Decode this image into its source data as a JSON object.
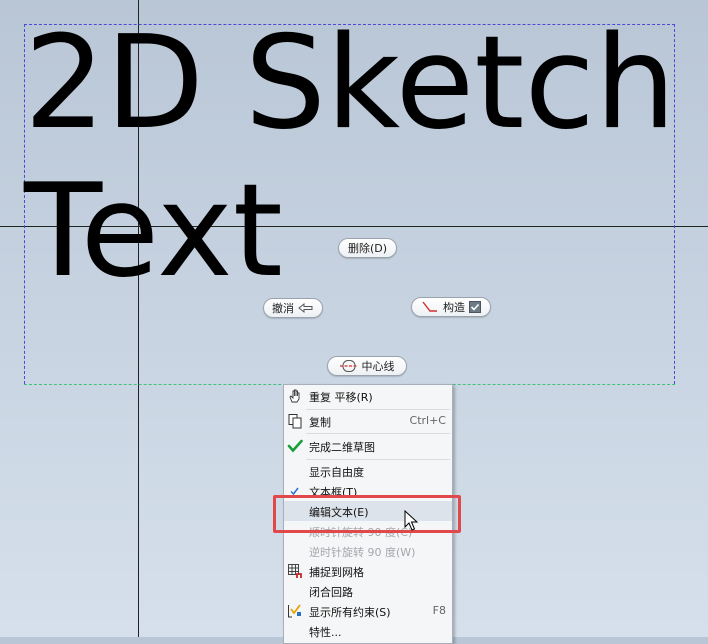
{
  "canvas": {
    "text_line1": "2D Sketch",
    "text_line2": "Text"
  },
  "mini_toolbar": {
    "delete_label": "删除(D)",
    "undo_label": "撤消",
    "construction_label": "构造",
    "centerline_label": "中心线"
  },
  "context_menu": {
    "items": [
      {
        "label": "重复 平移(R)",
        "shortcut": "",
        "icon": "hand-icon",
        "enabled": true
      },
      {
        "label": "复制",
        "shortcut": "Ctrl+C",
        "icon": "copy-icon",
        "enabled": true
      },
      {
        "label": "完成二维草图",
        "shortcut": "",
        "icon": "checkmark-icon",
        "enabled": true
      },
      {
        "label": "显示自由度",
        "shortcut": "",
        "icon": "",
        "enabled": true
      },
      {
        "label": "文本框(T)",
        "shortcut": "",
        "icon": "checkmark-small-icon",
        "enabled": true
      },
      {
        "label": "编辑文本(E)",
        "shortcut": "",
        "icon": "",
        "enabled": true
      },
      {
        "label": "顺时针旋转 90 度(C)",
        "shortcut": "",
        "icon": "",
        "enabled": false
      },
      {
        "label": "逆时针旋转 90 度(W)",
        "shortcut": "",
        "icon": "",
        "enabled": false
      },
      {
        "label": "捕捉到网格",
        "shortcut": "",
        "icon": "grid-snap-icon",
        "enabled": true
      },
      {
        "label": "闭合回路",
        "shortcut": "",
        "icon": "",
        "enabled": true
      },
      {
        "label": "显示所有约束(S)",
        "shortcut": "F8",
        "icon": "constraints-icon",
        "enabled": true
      },
      {
        "label": "特性...",
        "shortcut": "",
        "icon": "",
        "enabled": true
      }
    ]
  },
  "colors": {
    "highlight_box": "#e0484a",
    "check_green": "#1a9e3a"
  }
}
